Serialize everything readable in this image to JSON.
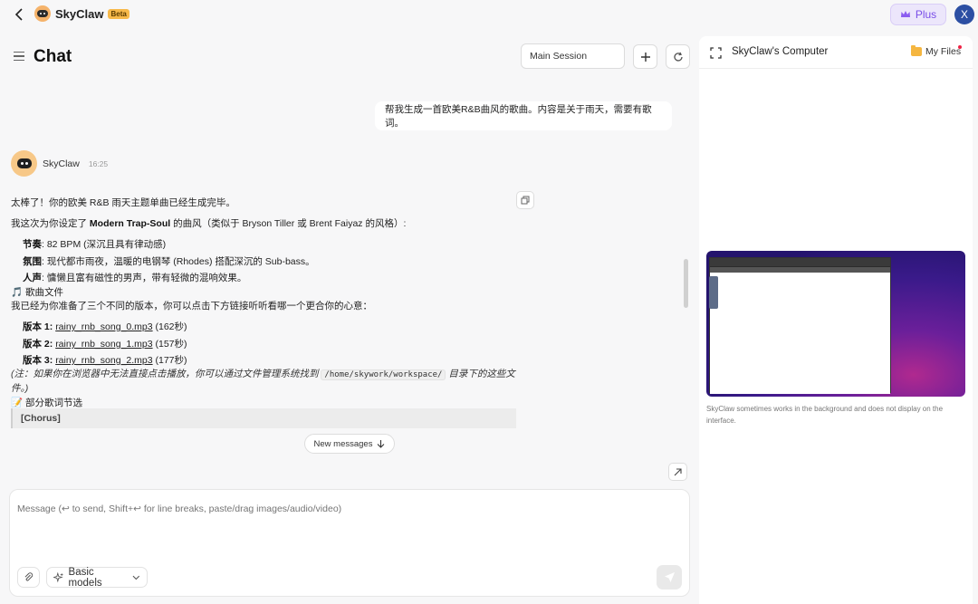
{
  "app": {
    "name": "SkyClaw",
    "badge": "Beta",
    "plus_label": "Plus",
    "avatar_initial": "X"
  },
  "header": {
    "title": "Chat",
    "session": "Main Session"
  },
  "user_message": "帮我生成一首欧美R&B曲风的歌曲。内容是关于雨天，需要有歌词。",
  "bot": {
    "name": "SkyClaw",
    "time": "16:25",
    "intro": "太棒了！你的欧美 R&B 雨天主题单曲已经生成完毕。",
    "style_pre": "我这次为你设定了 ",
    "style_bold": "Modern Trap-Soul",
    "style_post": " 的曲风（类似于 Bryson Tiller 或 Brent Faiyaz 的风格）:",
    "features": [
      {
        "label": "节奏",
        "text": ": 82 BPM (深沉且具有律动感)"
      },
      {
        "label": "氛围",
        "text": ": 现代都市雨夜，温暖的电钢琴 (Rhodes) 搭配深沉的 Sub-bass。"
      },
      {
        "label": "人声",
        "text": ": 慵懒且富有磁性的男声，带有轻微的混响效果。"
      }
    ],
    "files_heading": "🎵 歌曲文件",
    "files_intro": "我已经为你准备了三个不同的版本，你可以点击下方链接听听看哪一个更合你的心意：",
    "versions": [
      {
        "label": "版本 1",
        "file": "rainy_rnb_song_0.mp3",
        "duration": " (162秒)"
      },
      {
        "label": "版本 2",
        "file": "rainy_rnb_song_1.mp3",
        "duration": " (157秒)"
      },
      {
        "label": "版本 3",
        "file": "rainy_rnb_song_2.mp3",
        "duration": " (177秒)"
      }
    ],
    "note_pre": "(注：如果你在浏览器中无法直接点击播放，你可以通过文件管理系统找到 ",
    "note_path": "/home/skywork/workspace/",
    "note_post": " 目录下的这些文",
    "note_end": "件。)",
    "lyrics_heading": "📝 部分歌词节选",
    "chorus": "[Chorus]"
  },
  "new_messages_label": "New messages",
  "composer": {
    "placeholder": "Message (↩ to send, Shift+↩ for line breaks, paste/drag images/audio/video)",
    "model": "Basic models"
  },
  "computer_panel": {
    "title": "SkyClaw's Computer",
    "files_label": "My Files",
    "note": "SkyClaw sometimes works in the background and does not display on the interface."
  },
  "colors": {
    "accent_purple": "#7a4ee8",
    "avatar_blue": "#2c4fa3",
    "beta_yellow": "#f7b94a"
  }
}
